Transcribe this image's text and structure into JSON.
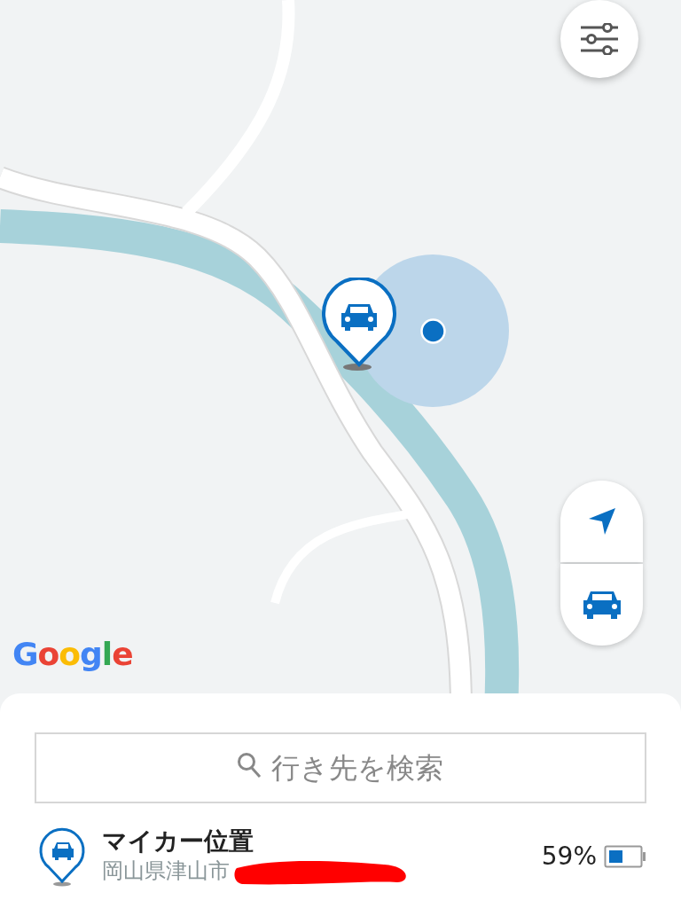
{
  "map": {
    "kind": "picture",
    "logo": "Google"
  },
  "search": {
    "placeholder": "行き先を検索"
  },
  "vehicle": {
    "title": "マイカー位置",
    "address": "岡山県津山市",
    "battery": "59%"
  }
}
